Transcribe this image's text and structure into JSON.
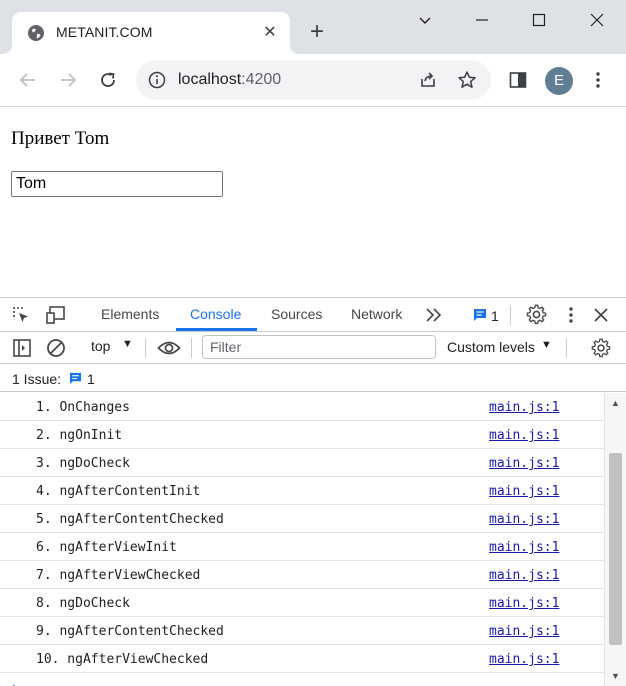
{
  "browser": {
    "tab": {
      "title": "METANIT.COM"
    },
    "address": {
      "host": "localhost",
      "port": ":4200"
    },
    "profile_initial": "E"
  },
  "page": {
    "greeting": "Привет Tom",
    "name_input_value": "Tom"
  },
  "devtools": {
    "tabs": [
      {
        "label": "Elements"
      },
      {
        "label": "Console"
      },
      {
        "label": "Sources"
      },
      {
        "label": "Network"
      }
    ],
    "issues_badge_count": "1",
    "context": "top",
    "filter_placeholder": "Filter",
    "log_levels": "Custom levels",
    "issues_label": "1 Issue:",
    "issues_count": "1",
    "logs": [
      {
        "msg": "1. OnChanges",
        "src": "main.js:1"
      },
      {
        "msg": "2. ngOnInit",
        "src": "main.js:1"
      },
      {
        "msg": "3. ngDoCheck",
        "src": "main.js:1"
      },
      {
        "msg": "4. ngAfterContentInit",
        "src": "main.js:1"
      },
      {
        "msg": "5. ngAfterContentChecked",
        "src": "main.js:1"
      },
      {
        "msg": "6. ngAfterViewInit",
        "src": "main.js:1"
      },
      {
        "msg": "7. ngAfterViewChecked",
        "src": "main.js:1"
      },
      {
        "msg": "8. ngDoCheck",
        "src": "main.js:1"
      },
      {
        "msg": "9. ngAfterContentChecked",
        "src": "main.js:1"
      },
      {
        "msg": "10. ngAfterViewChecked",
        "src": "main.js:1"
      }
    ]
  },
  "colors": {
    "accent": "#1a73e8",
    "tabstrip": "#dee1e6",
    "link": "#1a1aa6"
  }
}
